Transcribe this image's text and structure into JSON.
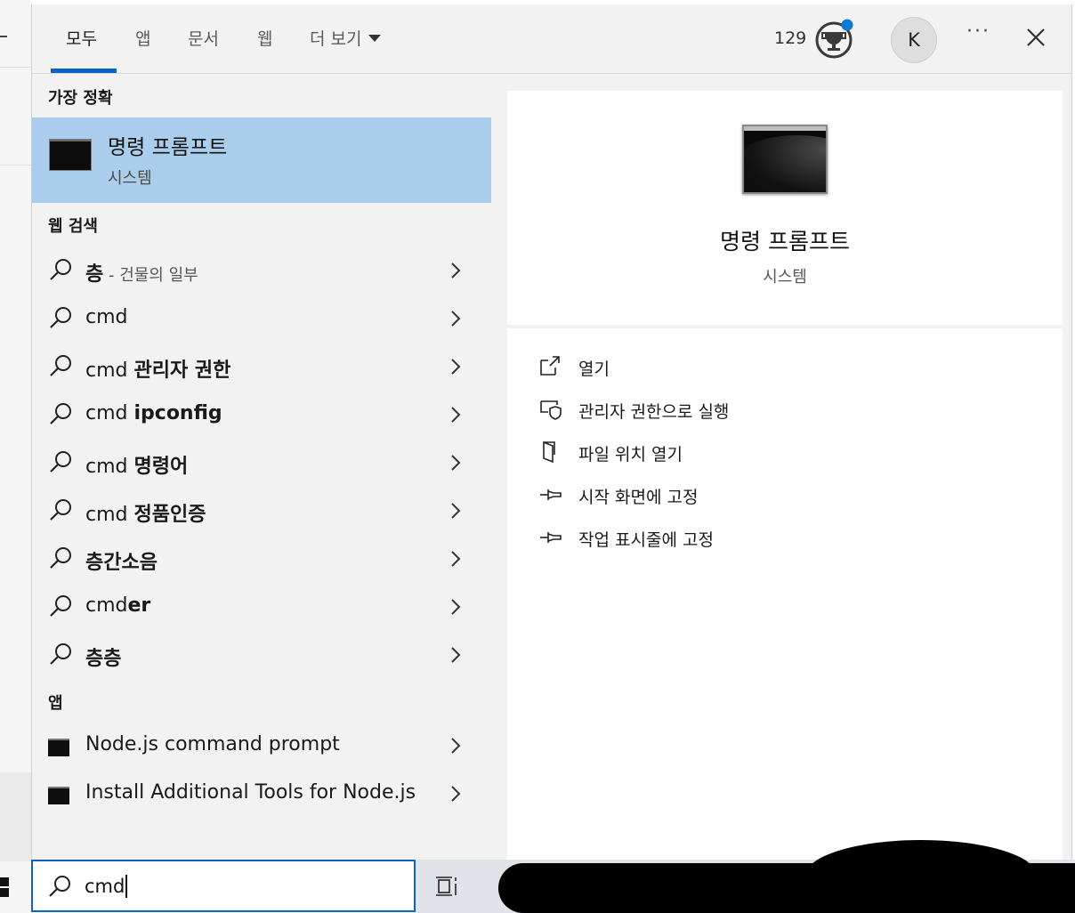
{
  "tabs": [
    {
      "label": "모두"
    },
    {
      "label": "앱"
    },
    {
      "label": "문서"
    },
    {
      "label": "웹"
    },
    {
      "label": "더 보기"
    }
  ],
  "header": {
    "rewards_points": "129",
    "avatar_initial": "K",
    "more_label": "···"
  },
  "best_match": {
    "heading": "가장 정확",
    "title": "명령 프롬프트",
    "subtitle": "시스템"
  },
  "web_search": {
    "heading": "웹 검색",
    "items": [
      {
        "prefix": "",
        "bold": "층",
        "suffix": " - 건물의 일부"
      },
      {
        "prefix": "cmd",
        "bold": "",
        "suffix": ""
      },
      {
        "prefix": "cmd ",
        "bold": "관리자 권한",
        "suffix": ""
      },
      {
        "prefix": "cmd ",
        "bold": "ipconfig",
        "suffix": ""
      },
      {
        "prefix": "cmd ",
        "bold": "명령어",
        "suffix": ""
      },
      {
        "prefix": "cmd ",
        "bold": "정품인증",
        "suffix": ""
      },
      {
        "prefix": "",
        "bold": "층간소음",
        "suffix": ""
      },
      {
        "prefix": "cmd",
        "bold": "er",
        "suffix": ""
      },
      {
        "prefix": "",
        "bold": "층층",
        "suffix": ""
      }
    ]
  },
  "apps": {
    "heading": "앱",
    "items": [
      {
        "label": "Node.js command prompt"
      },
      {
        "label": "Install Additional Tools for Node.js"
      }
    ]
  },
  "preview": {
    "title": "명령 프롬프트",
    "subtitle": "시스템",
    "actions": [
      {
        "label": "열기",
        "icon": "open-icon"
      },
      {
        "label": "관리자 권한으로 실행",
        "icon": "admin-shield-icon"
      },
      {
        "label": "파일 위치 열기",
        "icon": "file-location-icon"
      },
      {
        "label": "시작 화면에 고정",
        "icon": "pin-icon"
      },
      {
        "label": "작업 표시줄에 고정",
        "icon": "pin-icon"
      }
    ]
  },
  "search": {
    "value": "cmd"
  },
  "colors": {
    "accent": "#0a64c4",
    "selected": "#a9cdea",
    "rewards_dot": "#0a78d7"
  }
}
